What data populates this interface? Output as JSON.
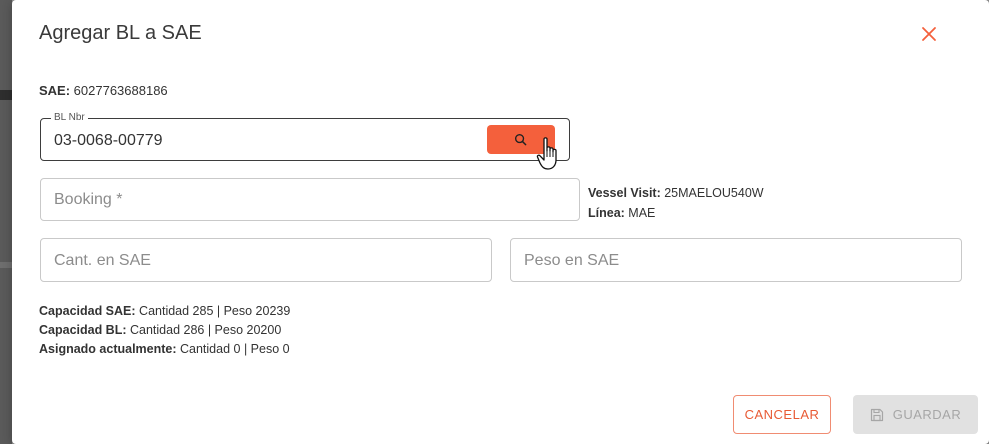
{
  "dialog": {
    "title": "Agregar BL a SAE"
  },
  "sae": {
    "label": "SAE:",
    "value": " 6027763688186"
  },
  "bl_field": {
    "label": "BL Nbr",
    "value": "03-0068-00779"
  },
  "booking_field": {
    "placeholder": "Booking *"
  },
  "vessel": {
    "visit_label": "Vessel Visit:",
    "visit_value": " 25MAELOU540W",
    "line_label": "Línea:",
    "line_value": " MAE"
  },
  "cant_field": {
    "placeholder": "Cant. en SAE"
  },
  "peso_field": {
    "placeholder": "Peso en SAE"
  },
  "capacity": {
    "sae_label": "Capacidad SAE:",
    "sae_value": " Cantidad 285 | Peso 20239",
    "bl_label": "Capacidad BL:",
    "bl_value": " Cantidad 286 | Peso 20200",
    "assigned_label": "Asignado actualmente:",
    "assigned_value": " Cantidad 0 | Peso 0"
  },
  "actions": {
    "cancel_label": "CANCELAR",
    "save_label": "GUARDAR"
  },
  "icons": {
    "close": "close-icon",
    "search": "search-icon",
    "cursor": "hand-pointer-icon",
    "save": "save-disk-icon"
  },
  "colors": {
    "accent": "#f4603c",
    "cancel_text": "#e85a34",
    "disabled_bg": "#e1e1e1"
  }
}
